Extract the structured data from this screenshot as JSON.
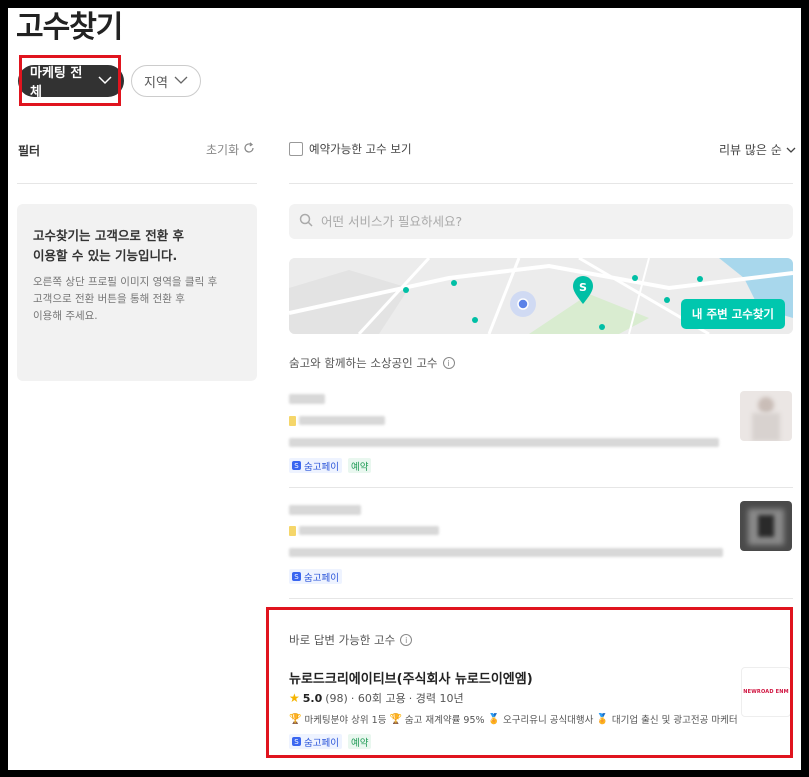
{
  "page": {
    "title": "고수찾기"
  },
  "chips": {
    "category": "마케팅 전체",
    "region": "지역"
  },
  "filter": {
    "label": "필터",
    "reset": "초기화"
  },
  "info_card": {
    "title": "고수찾기는 고객으로 전환 후\n이용할 수 있는 기능입니다.",
    "body": "오른쪽 상단 프로필 이미지 영역을 클릭 후\n고객으로 전환 버튼을 통해 전환 후\n이용해 주세요."
  },
  "toolbar": {
    "checkbox_label": "예약가능한 고수 보기",
    "sort": "리뷰 많은 순"
  },
  "search": {
    "placeholder": "어떤 서비스가 필요하세요?"
  },
  "map": {
    "button": "내 주변 고수찾기"
  },
  "section1": {
    "label": "숨고와 함께하는 소상공인 고수"
  },
  "badges": {
    "pay": "숨고페이",
    "reservation": "예약"
  },
  "section2": {
    "label": "바로 답변 가능한 고수"
  },
  "pro": {
    "name": "뉴로드크리에이티브(주식회사 뉴로드이엔엠)",
    "rating": "5.0",
    "reviews": "(98)",
    "hires": "· 60회 고용",
    "career": "· 경력 10년",
    "tags": [
      "마케팅분야 상위 1등",
      "숨고 재계약률 95%",
      "오구리유니 공식대행사",
      "대기업 출신 및 광고전공 마케터"
    ],
    "logo_text": "NEWROAD ENM"
  },
  "colors": {
    "accent": "#00c7ae",
    "dark_chip": "#323232",
    "highlight": "#e0141e"
  }
}
